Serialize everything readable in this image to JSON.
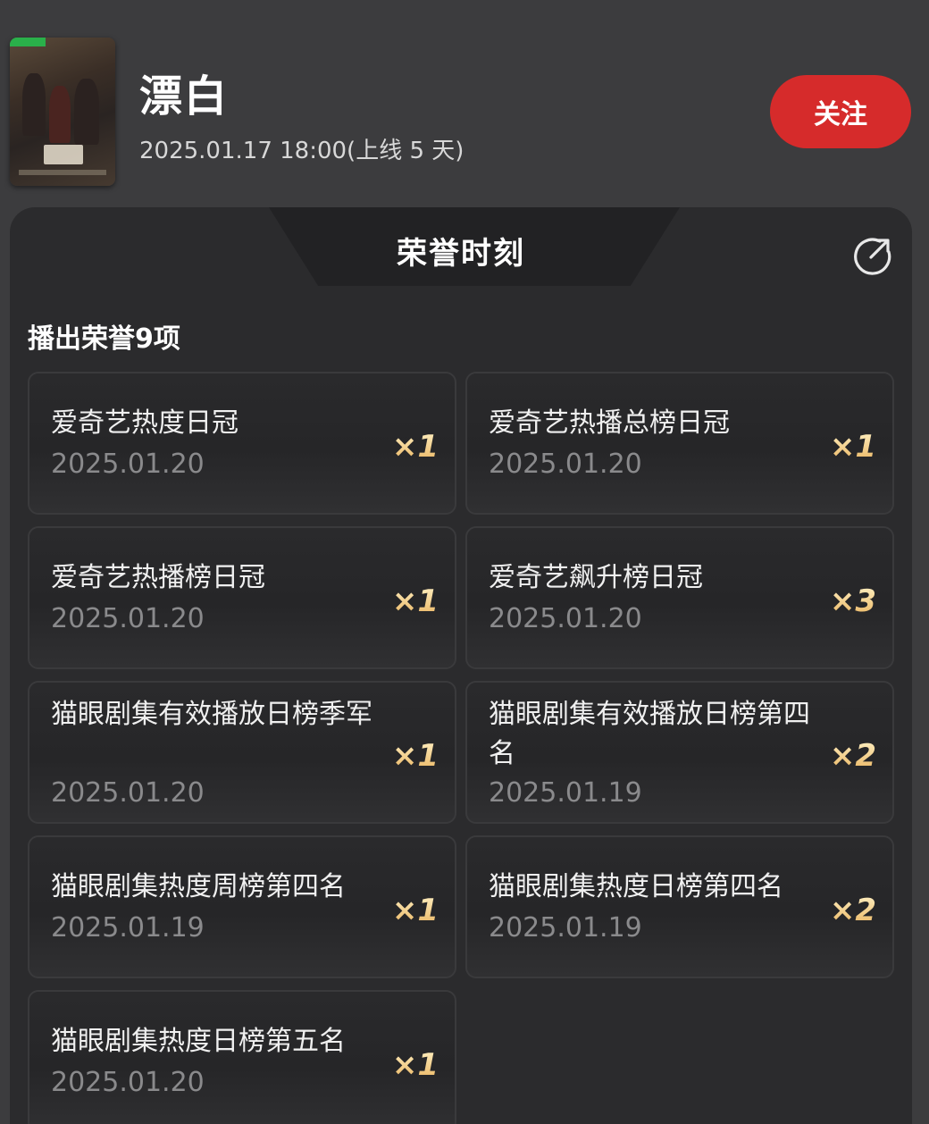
{
  "show": {
    "title": "漂白",
    "date": "2025.01.17 18:00(上线 5 天)",
    "follow_label": "关注"
  },
  "panel": {
    "title": "荣誉时刻",
    "section_label": "播出荣誉9项"
  },
  "honors": [
    {
      "name": "爱奇艺热度日冠",
      "date": "2025.01.20",
      "count": "×1"
    },
    {
      "name": "爱奇艺热播总榜日冠",
      "date": "2025.01.20",
      "count": "×1"
    },
    {
      "name": "爱奇艺热播榜日冠",
      "date": "2025.01.20",
      "count": "×1"
    },
    {
      "name": "爱奇艺飙升榜日冠",
      "date": "2025.01.20",
      "count": "×3"
    },
    {
      "name": "猫眼剧集有效播放日榜季军",
      "date": "2025.01.20",
      "count": "×1"
    },
    {
      "name": "猫眼剧集有效播放日榜第四名",
      "date": "2025.01.19",
      "count": "×2"
    },
    {
      "name": "猫眼剧集热度周榜第四名",
      "date": "2025.01.19",
      "count": "×1"
    },
    {
      "name": "猫眼剧集热度日榜第四名",
      "date": "2025.01.19",
      "count": "×2"
    },
    {
      "name": "猫眼剧集热度日榜第五名",
      "date": "2025.01.20",
      "count": "×1"
    }
  ],
  "icons": {
    "share": "share-icon",
    "poster": "poster-image"
  },
  "colors": {
    "accent": "#d62b2b",
    "gold": "#f2c870"
  }
}
